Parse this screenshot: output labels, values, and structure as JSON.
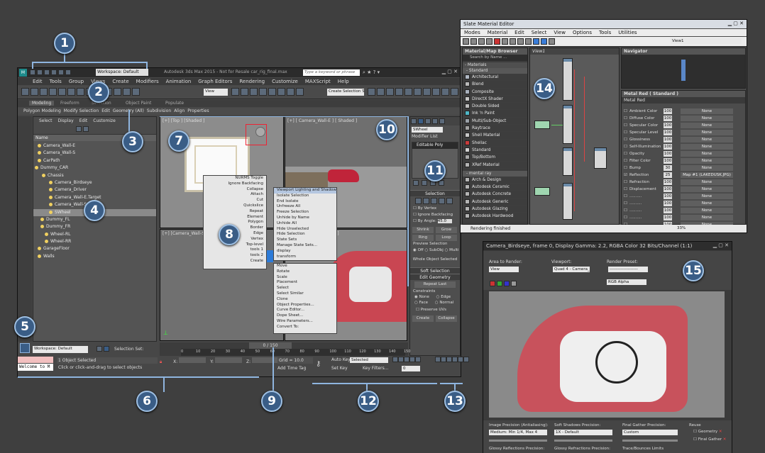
{
  "main": {
    "title": "Autodesk 3ds Max 2015  - Not for Resale   car_rig_final.max",
    "workspace_label": "Workspace: Default",
    "search_placeholder": "Type a keyword or phrase",
    "menus": [
      "Edit",
      "Tools",
      "Group",
      "Views",
      "Create",
      "Modifiers",
      "Animation",
      "Graph Editors",
      "Rendering",
      "Customize",
      "MAXScript",
      "Help"
    ],
    "view_dropdown": "View",
    "selection_set": "Create Selection S",
    "ribbon_tabs": [
      "Modeling",
      "Freeform",
      "Selection",
      "Object Paint",
      "Populate"
    ],
    "ribbon_sub": [
      "Polygon Modeling",
      "Modify Selection",
      "Edit",
      "Geometry (All)",
      "Subdivision",
      "Align",
      "Properties"
    ]
  },
  "scene_explorer": {
    "tabs": [
      "Select",
      "Display",
      "Edit",
      "Customize"
    ],
    "column": "Name",
    "items": [
      "Camera_Wall-E",
      "Camera_Wall-S",
      "CarPath",
      "Dummy_CAR",
      "Chassis",
      "Camera_Birdseye",
      "Camera_Driver",
      "Camera_Wall-E.Target",
      "Camera_Wall-S.Target",
      "SWheel",
      "Dummy_FL",
      "Dummy_FR",
      "Wheel-RL",
      "Wheel-RR",
      "GarageFloor",
      "Walls"
    ],
    "workspace_bottom": "Workspace: Default",
    "selection_set": "Selection Set:"
  },
  "viewports": {
    "top": "[+] [Top ] [Shaded ]",
    "camera_e": "[+] [ Camera_Wall-E ] [ Shaded ]",
    "camera_s": "[+] [Camera_Wall-S ]",
    "persp_tag": "ded ]"
  },
  "quad_menu": {
    "left": [
      "NURMS Toggle",
      "Ignore Backfacing",
      "Collapse",
      "Attach",
      "Cut",
      "Quickslice",
      "Repeat",
      "Element",
      "Polygon",
      "Border",
      "Edge",
      "Vertex",
      "Top-level",
      "tools 1",
      "tools 2",
      "Create"
    ],
    "right_top": [
      "Viewport Lighting and Shadows",
      "Isolate Selection",
      "End Isolate",
      "Unfreeze All",
      "Freeze Selection",
      "Unhide by Name",
      "Unhide All",
      "Hide Unselected",
      "Hide Selection",
      "State Sets",
      "Manage State Sets...",
      "display",
      "transform"
    ],
    "right_bottom": [
      "Move",
      "Rotate",
      "Scale",
      "Placement",
      "Select",
      "Select Similar",
      "Clone",
      "Object Properties...",
      "Curve Editor...",
      "Dope Sheet...",
      "Wire Parameters...",
      "Convert To:"
    ]
  },
  "command_panel": {
    "object_name": "SWheel",
    "modifier_list": "Modifier List",
    "stack_item": "Editable Poly",
    "selection_title": "Selection",
    "by_vertex": "By Vertex",
    "ignore_backfacing": "Ignore Backfacing",
    "by_angle": "By Angle:",
    "angle_value": "45.0",
    "shrink": "Shrink",
    "grow": "Grow",
    "ring": "Ring",
    "loop": "Loop",
    "preview_selection": "Preview Selection",
    "preview_options": [
      "Off",
      "SubObj",
      "Multi"
    ],
    "whole_object": "Whole Object Selected",
    "soft_selection": "Soft Selection",
    "edit_geometry": "Edit Geometry",
    "repeat_last": "Repeat Last",
    "constraints": "Constraints",
    "constraint_opts": [
      "None",
      "Edge",
      "Face",
      "Normal"
    ],
    "preserve_uvs": "Preserve UVs",
    "create": "Create",
    "collapse": "Collapse"
  },
  "status": {
    "frame": "0 / 150",
    "ticks": [
      "0",
      "10",
      "20",
      "30",
      "40",
      "50",
      "60",
      "70",
      "80",
      "90",
      "100",
      "110",
      "120",
      "130",
      "140",
      "150"
    ],
    "maxscript": "Welcome to M",
    "selected": "1 Object Selected",
    "prompt": "Click or click-and-drag to select objects",
    "x_label": "X:",
    "y_label": "Y:",
    "z_label": "Z:",
    "grid": "Grid = 10.0",
    "add_time_tag": "Add Time Tag",
    "auto_key": "Auto Key",
    "key_mode": "Selected",
    "set_key": "Set Key",
    "key_filters": "Key Filters...",
    "frame_field": "0"
  },
  "material_editor": {
    "title": "Slate Material Editor",
    "menus": [
      "Modes",
      "Material",
      "Edit",
      "Select",
      "View",
      "Options",
      "Tools",
      "Utilities"
    ],
    "view_dropdown": "View1",
    "browser_title": "Material/Map Browser",
    "search": "Search by Name ...",
    "view_tab": "View1",
    "navigator": "Navigator",
    "groups": [
      "- Materials",
      "- Standard",
      "- mental ray"
    ],
    "standard": [
      "Architectural",
      "Blend",
      "Composite",
      "DirectX Shader",
      "Double Sided",
      "Ink 'n Paint",
      "Multi/Sub-Object",
      "Raytrace",
      "Shell Material",
      "Shellac",
      "Standard",
      "Top/Bottom",
      "XRef Material"
    ],
    "mental_ray": [
      "Arch & Design",
      "Autodesk Ceramic",
      "Autodesk Concrete",
      "Autodesk Generic",
      "Autodesk Glazing",
      "Autodesk Hardwood"
    ],
    "material_title": "Metal Red  ( Standard )",
    "material_name": "Metal Red",
    "params": [
      {
        "label": "Ambient Color",
        "value": "100",
        "map": "None"
      },
      {
        "label": "Diffuse Color",
        "value": "100",
        "map": "None"
      },
      {
        "label": "Specular Color",
        "value": "100",
        "map": "None"
      },
      {
        "label": "Specular Level",
        "value": "100",
        "map": "None"
      },
      {
        "label": "Glossiness",
        "value": "100",
        "map": "None"
      },
      {
        "label": "Self-Illumination",
        "value": "100",
        "map": "None"
      },
      {
        "label": "Opacity",
        "value": "100",
        "map": "None"
      },
      {
        "label": "Filter Color",
        "value": "100",
        "map": "None"
      },
      {
        "label": "Bump",
        "value": "30",
        "map": "None"
      },
      {
        "label": "Reflection",
        "value": "25",
        "map": "Map #1 (LAKEDUSK.JPG)"
      },
      {
        "label": "Refraction",
        "value": "100",
        "map": "None"
      },
      {
        "label": "Displacement",
        "value": "100",
        "map": "None"
      },
      {
        "label": "..........",
        "value": "100",
        "map": "None"
      },
      {
        "label": "..........",
        "value": "100",
        "map": "None"
      },
      {
        "label": "..........",
        "value": "100",
        "map": "None"
      },
      {
        "label": "..........",
        "value": "100",
        "map": "None"
      },
      {
        "label": "..........",
        "value": "100",
        "map": "None"
      }
    ],
    "status": "Rendering finished",
    "zoom": "33%"
  },
  "render_window": {
    "title": "Camera_Birdseye, frame 0, Display Gamma: 2.2, RGBA Color 32 Bits/Channel (1:1)",
    "area_label": "Area to Render:",
    "area_value": "View",
    "viewport_label": "Viewport:",
    "viewport_value": "Quad 4 - Camera_",
    "preset_label": "Render Preset:",
    "preset_value": "--------------------",
    "channel": "RGB Alpha",
    "image_precision": "Image Precision (Antialiasing):",
    "image_precision_value": "Medium: Min 1/4, Max 4",
    "soft_shadows": "Soft Shadows Precision:",
    "soft_shadows_value": "1X - Default",
    "final_gather": "Final Gather Precision:",
    "final_gather_value": "Custom",
    "reuse": "Reuse",
    "geometry": "Geometry",
    "final_gather_chk": "Final Gather",
    "glossy_refl": "Glossy Reflections Precision:",
    "glossy_refr": "Glossy Refractions Precision:",
    "trace": "Trace/Bounces Limits"
  },
  "callouts": [
    "1",
    "2",
    "3",
    "4",
    "5",
    "6",
    "7",
    "8",
    "9",
    "10",
    "11",
    "12",
    "13",
    "14",
    "15"
  ],
  "colors": {
    "callout": "#3a5d86",
    "callout_border": "#9fc0e3",
    "accent": "#8fb5df"
  }
}
